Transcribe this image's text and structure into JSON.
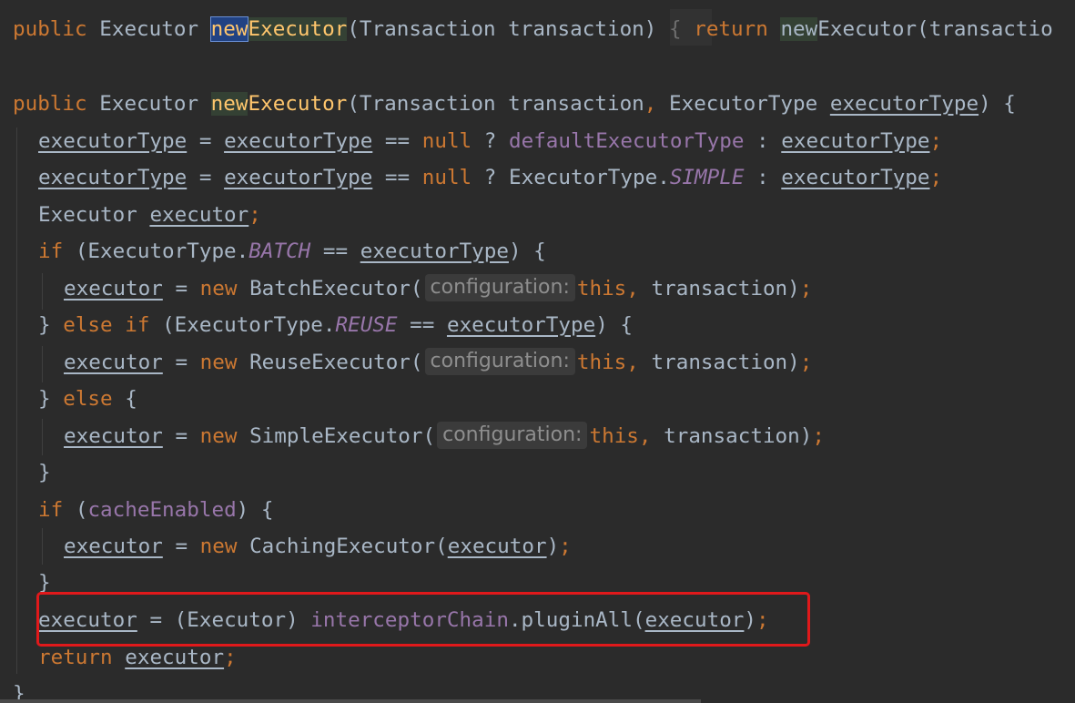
{
  "line1": {
    "public": "public",
    "ret_type": "Executor",
    "name_a": "new",
    "name_b": "Executor",
    "params": "(Transaction transaction)",
    "brace": "{",
    "return": "return",
    "call_a": "new",
    "call_b": "Executor",
    "call_rest": "(transactio"
  },
  "line2": {
    "public": "public",
    "ret_type": "Executor",
    "name_a": "new",
    "name_b": "Executor",
    "params_a": "(Transaction transaction",
    "comma": ",",
    "params_b": "ExecutorType",
    "param_var": "executorType",
    "close": ") {"
  },
  "line3": {
    "lhs": "executorType",
    "eq": "=",
    "v1": "executorType",
    "op": "==",
    "null": "null",
    "q": "?",
    "field": "defaultExecutorType",
    "colon": ":",
    "v2": "executorType",
    "semi": ";"
  },
  "line4": {
    "lhs": "executorType",
    "eq": "=",
    "v1": "executorType",
    "op": "==",
    "null": "null",
    "q": "?",
    "cls": "ExecutorType.",
    "const": "SIMPLE",
    "colon": ":",
    "v2": "executorType",
    "semi": ";"
  },
  "line5": {
    "type": "Executor",
    "var": "executor",
    "semi": ";"
  },
  "line6": {
    "if": "if",
    "open": "(ExecutorType.",
    "const": "BATCH",
    "op": "==",
    "var": "executorType",
    "close": ") {"
  },
  "line7": {
    "var": "executor",
    "eq": "=",
    "new": "new",
    "cls": "BatchExecutor(",
    "hint": "configuration:",
    "this": "this",
    "comma": ",",
    "arg": "transaction)",
    "semi": ";"
  },
  "line8": {
    "brace": "}",
    "else": "else",
    "if": "if",
    "open": "(ExecutorType.",
    "const": "REUSE",
    "op": "==",
    "var": "executorType",
    "close": ") {"
  },
  "line9": {
    "var": "executor",
    "eq": "=",
    "new": "new",
    "cls": "ReuseExecutor(",
    "hint": "configuration:",
    "this": "this",
    "comma": ",",
    "arg": "transaction)",
    "semi": ";"
  },
  "line10": {
    "brace": "}",
    "else": "else",
    "open": "{"
  },
  "line11": {
    "var": "executor",
    "eq": "=",
    "new": "new",
    "cls": "SimpleExecutor(",
    "hint": "configuration:",
    "this": "this",
    "comma": ",",
    "arg": "transaction)",
    "semi": ";"
  },
  "line12": {
    "brace": "}"
  },
  "line13": {
    "if": "if",
    "open": "(",
    "field": "cacheEnabled",
    "close": ") {"
  },
  "line14": {
    "var": "executor",
    "eq": "=",
    "new": "new",
    "cls": "CachingExecutor(",
    "arg": "executor",
    "close": ")",
    "semi": ";"
  },
  "line15": {
    "brace": "}"
  },
  "line16": {
    "var": "executor",
    "eq": "=",
    "cast": "(Executor)",
    "field": "interceptorChain",
    "call": ".pluginAll(",
    "arg": "executor",
    "close": ")",
    "semi": ";"
  },
  "line17": {
    "return": "return",
    "var": "executor",
    "semi": ";"
  },
  "line18": {
    "brace": "}"
  },
  "colors": {
    "background": "#2b2b2b",
    "keyword": "#cc7832",
    "text": "#a9b7c6",
    "field": "#9876aa",
    "method": "#ffc66d",
    "highlight_box": "#e0191b"
  }
}
